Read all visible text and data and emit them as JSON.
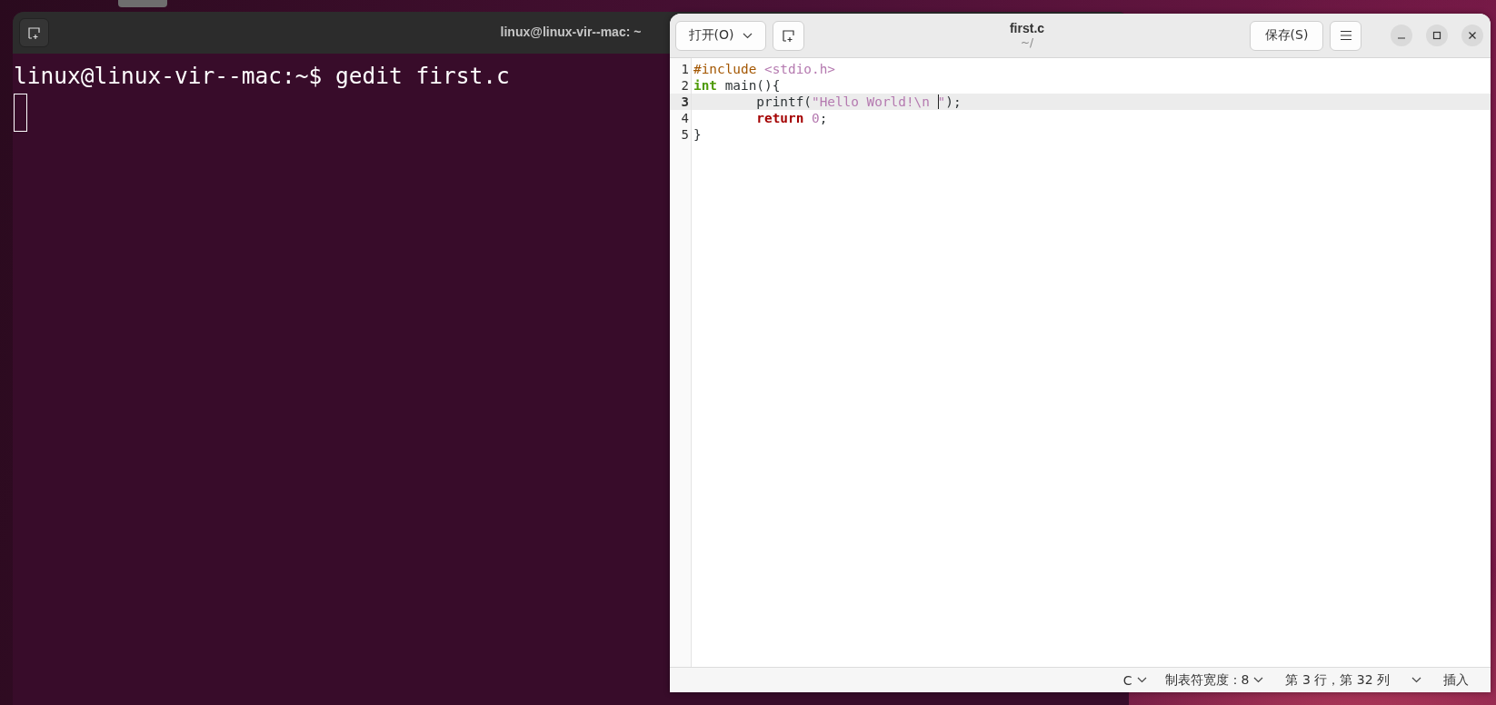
{
  "terminal": {
    "title": "linux@linux-vir--mac: ~",
    "lines": [
      "linux@linux-vir--mac:~$ gedit first.c"
    ],
    "cursor_focused": false
  },
  "gedit": {
    "open_button": "打开(O)",
    "title": "first.c",
    "subtitle": "~/",
    "save_button": "保存(S)",
    "code_lines": [
      {
        "number": "1",
        "current": false,
        "tokens": [
          {
            "kind": "preproc",
            "text": "#include "
          },
          {
            "kind": "string",
            "text": "<stdio.h>"
          }
        ]
      },
      {
        "number": "2",
        "current": false,
        "tokens": [
          {
            "kind": "type",
            "text": "int"
          },
          {
            "kind": "plain",
            "text": " main(){"
          }
        ]
      },
      {
        "number": "3",
        "current": true,
        "tokens": [
          {
            "kind": "plain",
            "text": "        printf("
          },
          {
            "kind": "string",
            "text": "\"Hello World!\\n "
          },
          {
            "kind": "cursor"
          },
          {
            "kind": "string",
            "text": "\""
          },
          {
            "kind": "plain",
            "text": ");"
          }
        ]
      },
      {
        "number": "4",
        "current": false,
        "tokens": [
          {
            "kind": "keyword",
            "text": "        return"
          },
          {
            "kind": "number",
            "text": " 0"
          },
          {
            "kind": "plain",
            "text": ";"
          }
        ]
      },
      {
        "number": "5",
        "current": false,
        "tokens": [
          {
            "kind": "plain",
            "text": "}"
          }
        ]
      }
    ],
    "status_bar": [
      {
        "kind": "dropdown",
        "text": "C"
      },
      {
        "kind": "dropdown",
        "text": "制表符宽度：8"
      },
      {
        "kind": "label",
        "text": "第 3 行，第 32 列"
      },
      {
        "kind": "dropdown"
      },
      {
        "kind": "label",
        "text": "插入"
      }
    ]
  }
}
